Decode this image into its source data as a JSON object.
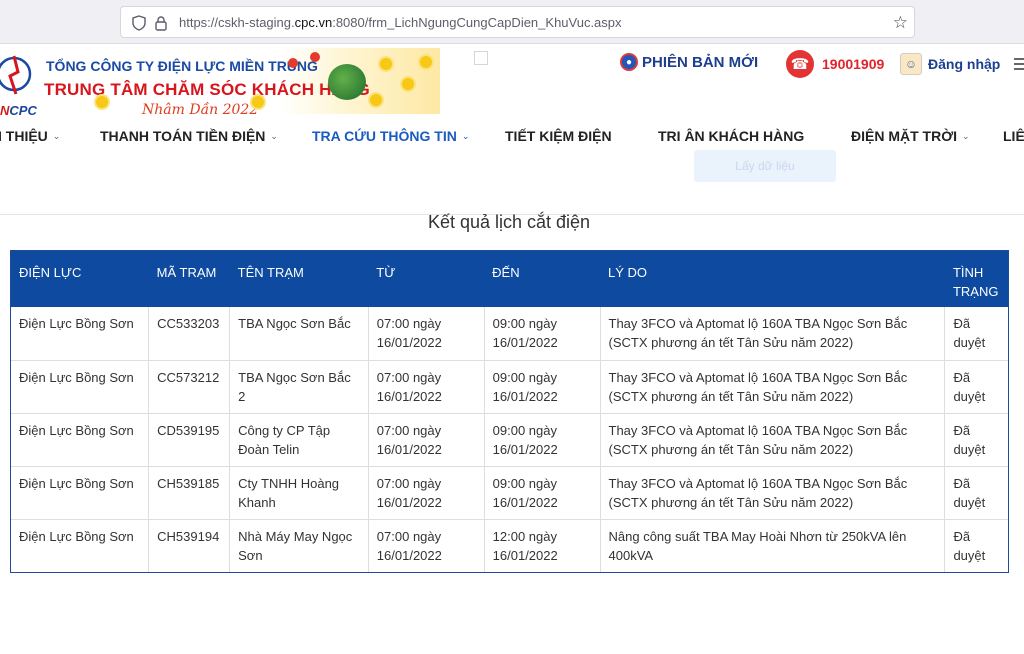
{
  "browser": {
    "url_prefix": "https://cskh-staging.",
    "url_host": "cpc.vn",
    "url_suffix": ":8080/frm_LichNgungCungCapDien_KhuVuc.aspx"
  },
  "header": {
    "logo_text": "CPC",
    "logo_text_prefix": "N",
    "corp_name": "TỔNG CÔNG TY ĐIỆN LỰC MIỀN TRUNG",
    "center_name": "TRUNG TÂM CHĂM SÓC KHÁCH HÀNG",
    "tet_text": "Nhâm Dần 2022",
    "new_version": "PHIÊN BẢN MỚI",
    "hotline": "19001909",
    "login": "Đăng nhập"
  },
  "nav": {
    "items": [
      {
        "label": "I THIỆU",
        "has_chevron": true
      },
      {
        "label": "THANH TOÁN TIỀN ĐIỆN",
        "has_chevron": true
      },
      {
        "label": "TRA CỨU THÔNG TIN",
        "has_chevron": true,
        "active": true
      },
      {
        "label": "TIẾT KIỆM ĐIỆN",
        "has_chevron": false
      },
      {
        "label": "TRI ÂN KHÁCH HÀNG",
        "has_chevron": false
      },
      {
        "label": "ĐIỆN MẶT TRỜI",
        "has_chevron": true
      },
      {
        "label": "LIÊ",
        "has_chevron": false
      }
    ],
    "faint_button": "Lấy dữ liệu"
  },
  "result": {
    "title": "Kết quả lịch cắt điện",
    "columns": [
      "ĐIỆN LỰC",
      "MÃ TRẠM",
      "TÊN TRẠM",
      "TỪ",
      "ĐẾN",
      "LÝ DO",
      "TÌNH TRẠNG"
    ],
    "rows": [
      [
        "Điện Lực Bồng Sơn",
        "CC533203",
        "TBA Ngọc Sơn Bắc",
        "07:00 ngày 16/01/2022",
        "09:00 ngày 16/01/2022",
        "Thay 3FCO và Aptomat lộ 160A TBA Ngọc Sơn Bắc (SCTX phương án tết Tân Sửu năm 2022)",
        "Đã duyệt"
      ],
      [
        "Điện Lực Bồng Sơn",
        "CC573212",
        "TBA Ngọc Sơn Bắc 2",
        "07:00 ngày 16/01/2022",
        "09:00 ngày 16/01/2022",
        "Thay 3FCO và Aptomat lộ 160A TBA Ngọc Sơn Bắc (SCTX phương án tết Tân Sửu năm 2022)",
        "Đã duyệt"
      ],
      [
        "Điện Lực Bồng Sơn",
        "CD539195",
        "Công ty CP Tập Đoàn Telin",
        "07:00 ngày 16/01/2022",
        "09:00 ngày 16/01/2022",
        "Thay 3FCO và Aptomat lộ 160A TBA Ngọc Sơn Bắc (SCTX phương án tết Tân Sửu năm 2022)",
        "Đã duyệt"
      ],
      [
        "Điện Lực Bồng Sơn",
        "CH539185",
        "Cty TNHH Hoàng Khanh",
        "07:00 ngày 16/01/2022",
        "09:00 ngày 16/01/2022",
        "Thay 3FCO và Aptomat lộ 160A TBA Ngọc Sơn Bắc (SCTX phương án tết Tân Sửu năm 2022)",
        "Đã duyệt"
      ],
      [
        "Điện Lực Bồng Sơn",
        "CH539194",
        "Nhà Máy May Ngọc Sơn",
        "07:00 ngày 16/01/2022",
        "12:00 ngày 16/01/2022",
        "Nâng công suất TBA May Hoài Nhơn từ 250kVA lên 400kVA",
        "Đã duyệt"
      ]
    ]
  },
  "icons": {
    "shield": "shield-icon",
    "lock": "lock-icon",
    "star": "star-icon",
    "phone": "phone-icon",
    "avatar": "avatar-icon",
    "menu": "menu-icon"
  },
  "colors": {
    "brand_blue": "#1b4aa5",
    "brand_red": "#d8151c",
    "table_header": "#0d4aa0",
    "nav_active": "#1a5bbf"
  }
}
